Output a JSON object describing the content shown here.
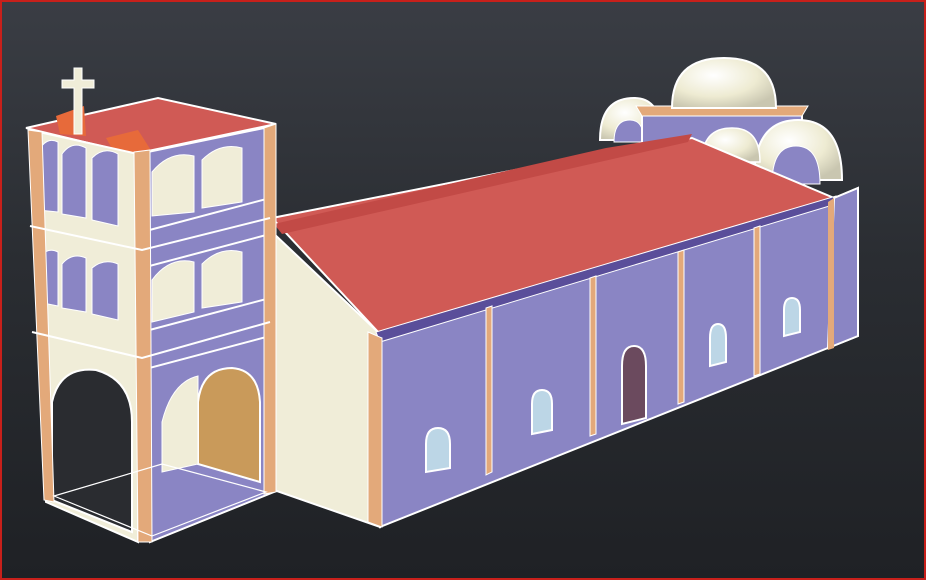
{
  "viewport": {
    "kind": "cad-3d-model-view",
    "subject": "church",
    "colors": {
      "background_top": "#3a3d44",
      "background_bottom": "#1f2125",
      "frame": "#c8201b",
      "roof": "#d05a55",
      "wall": "#8a85c4",
      "wall_light": "#f0edd8",
      "trim": "#e3a97a",
      "door": "#c99a5a",
      "dome": "#f3f0dc",
      "edge": "#ffffff"
    }
  }
}
